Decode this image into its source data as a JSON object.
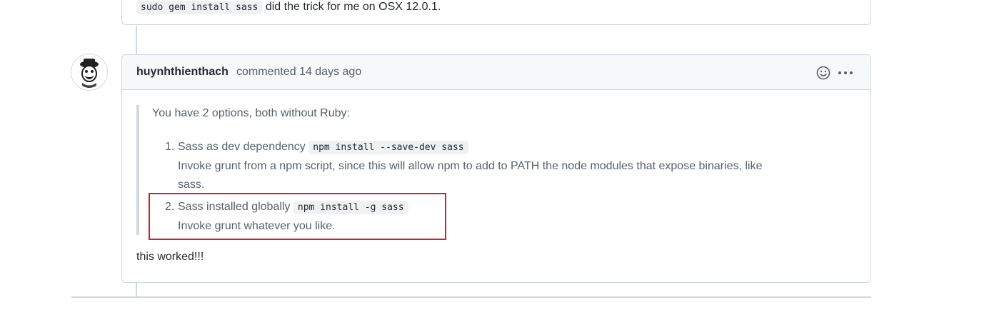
{
  "previous_comment": {
    "code": "sudo gem install sass",
    "text": "did the trick for me on OSX 12.0.1."
  },
  "comment": {
    "author": "huynhthienthach",
    "meta": "commented 14 days ago",
    "quote_intro": "You have 2 options, both without Ruby:",
    "options": [
      {
        "number": "1.",
        "title": "Sass as dev dependency",
        "code": "npm install --save-dev sass",
        "line2": "Invoke grunt from a npm script, since this will allow npm to add to PATH the node modules that expose binaries, like",
        "line3": "sass."
      },
      {
        "number": "2.",
        "title": "Sass installed globally",
        "code": "npm install -g sass",
        "line2": "Invoke grunt whatever you like."
      }
    ],
    "reply": "this worked!!!"
  },
  "icons": {
    "add_reaction": "smiley-icon",
    "more": "kebab-horizontal-icon",
    "avatar": "user-avatar"
  },
  "colors": {
    "highlight": "#d0202d",
    "border": "#d0d7de",
    "header_bg": "#f6f8fa"
  }
}
